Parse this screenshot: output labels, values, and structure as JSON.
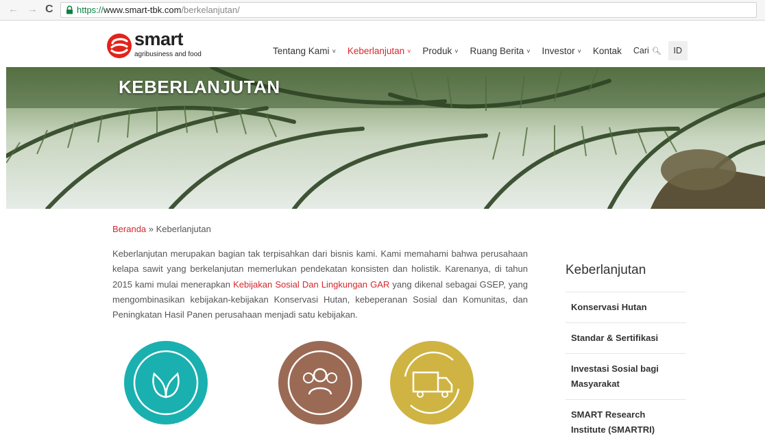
{
  "browser": {
    "url_scheme": "https://",
    "url_host": "www.smart-tbk.com",
    "url_path": "/berkelanjutan/",
    "back_icon": "←",
    "forward_icon": "→",
    "reload_icon": "C"
  },
  "logo": {
    "word": "smart",
    "tagline": "agribusiness and food",
    "brand_color": "#e2231a"
  },
  "menu": {
    "items": [
      {
        "label": "Tentang Kami",
        "chevron": "v"
      },
      {
        "label": "Keberlanjutan",
        "chevron": "v"
      },
      {
        "label": "Produk",
        "chevron": "v"
      },
      {
        "label": "Ruang Berita",
        "chevron": "v"
      },
      {
        "label": "Investor",
        "chevron": "v"
      },
      {
        "label": "Kontak",
        "chevron": ""
      }
    ],
    "search_label": "Cari",
    "lang": "ID",
    "active_color": "#d7262c"
  },
  "hero": {
    "title": "KEBERLANJUTAN"
  },
  "breadcrumb": {
    "home": "Beranda",
    "separator": " » ",
    "current": "Keberlanjutan"
  },
  "intro": {
    "part1": "Keberlanjutan merupakan bagian tak terpisahkan dari bisnis kami. Kami memahami bahwa perusahaan kelapa sawit yang berkelanjutan memerlukan pendekatan konsisten dan holistik. Karenanya, di tahun 2015 kami mulai menerapkan ",
    "link": "Kebijakan Sosial Dan Lingkungan GAR",
    "part2": " yang dikenal sebagai GSEP, yang mengombinasikan kebijakan-kebijakan Konservasi Hutan, kebeperanan Sosial dan Komunitas, dan Peningkatan Hasil Panen perusahaan menjadi satu kebijakan."
  },
  "icons": [
    {
      "name": "leaf-icon",
      "color": "#1ab0b0"
    },
    {
      "name": "people-icon",
      "color": "#9b6a55"
    },
    {
      "name": "truck-cycle-icon",
      "color": "#cfb443"
    }
  ],
  "sidebar": {
    "title": "Keberlanjutan",
    "items": [
      {
        "label": "Konservasi Hutan"
      },
      {
        "label": "Standar & Sertifikasi"
      },
      {
        "label": "Investasi Sosial bagi Masyarakat"
      },
      {
        "label": "SMART Research Institute (SMARTRI)"
      }
    ]
  }
}
